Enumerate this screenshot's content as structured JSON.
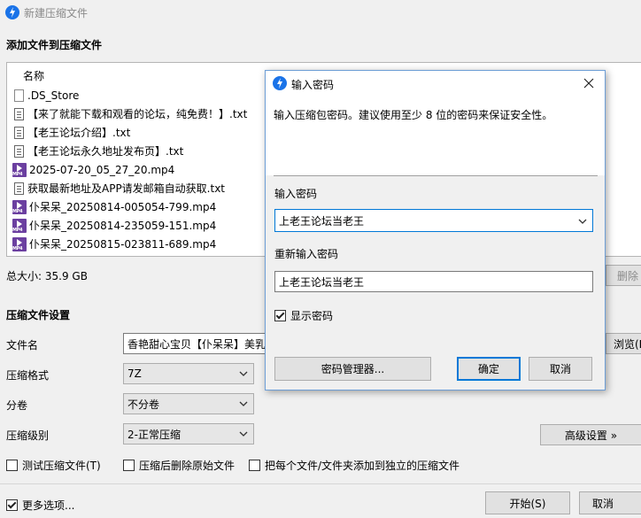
{
  "window": {
    "title": "新建压缩文件"
  },
  "files_section": {
    "heading": "添加文件到压缩文件",
    "column_name": "名称",
    "items": [
      {
        "name": ".DS_Store",
        "icon": "blank-file-icon"
      },
      {
        "name": "【来了就能下载和观看的论坛，纯免费！】.txt",
        "icon": "text-file-icon"
      },
      {
        "name": "【老王论坛介绍】.txt",
        "icon": "text-file-icon"
      },
      {
        "name": "【老王论坛永久地址发布页】.txt",
        "icon": "text-file-icon"
      },
      {
        "name": "2025-07-20_05_27_20.mp4",
        "icon": "mp4-file-icon"
      },
      {
        "name": "获取最新地址及APP请发邮箱自动获取.txt",
        "icon": "text-file-icon"
      },
      {
        "name": "仆呆呆_20250814-005054-799.mp4",
        "icon": "mp4-file-icon"
      },
      {
        "name": "仆呆呆_20250814-235059-151.mp4",
        "icon": "mp4-file-icon"
      },
      {
        "name": "仆呆呆_20250815-023811-689.mp4",
        "icon": "mp4-file-icon"
      }
    ],
    "total_size": "总大小: 35.9 GB",
    "delete_label": "删除"
  },
  "settings": {
    "heading": "压缩文件设置",
    "filename_label": "文件名",
    "filename_value": "香艳甜心宝贝【仆呆呆】美乳",
    "browse_label": "浏览(B)",
    "format_label": "压缩格式",
    "format_value": "7Z",
    "split_label": "分卷",
    "split_value": "不分卷",
    "level_label": "压缩级别",
    "level_value": "2-正常压缩",
    "advanced_label": "高级设置 »",
    "test_label": "测试压缩文件(T)",
    "delete_after_label": "压缩后删除原始文件",
    "separate_label": "把每个文件/文件夹添加到独立的压缩文件",
    "more_options_label": "更多选项...",
    "start_label": "开始(S)",
    "cancel_label": "取消"
  },
  "password_dialog": {
    "title": "输入密码",
    "hint": "输入压缩包密码。建议使用至少 8 位的密码来保证安全性。",
    "password_label": "输入密码",
    "password_value": "上老王论坛当老王",
    "reenter_label": "重新输入密码",
    "reenter_value": "上老王论坛当老王",
    "show_password_label": "显示密码",
    "show_password_checked": true,
    "manager_label": "密码管理器...",
    "ok_label": "确定",
    "cancel_label": "取消"
  },
  "colors": {
    "accent": "#0078d7",
    "app_icon": "#1a73e8",
    "mp4_icon": "#6b3fa0"
  }
}
